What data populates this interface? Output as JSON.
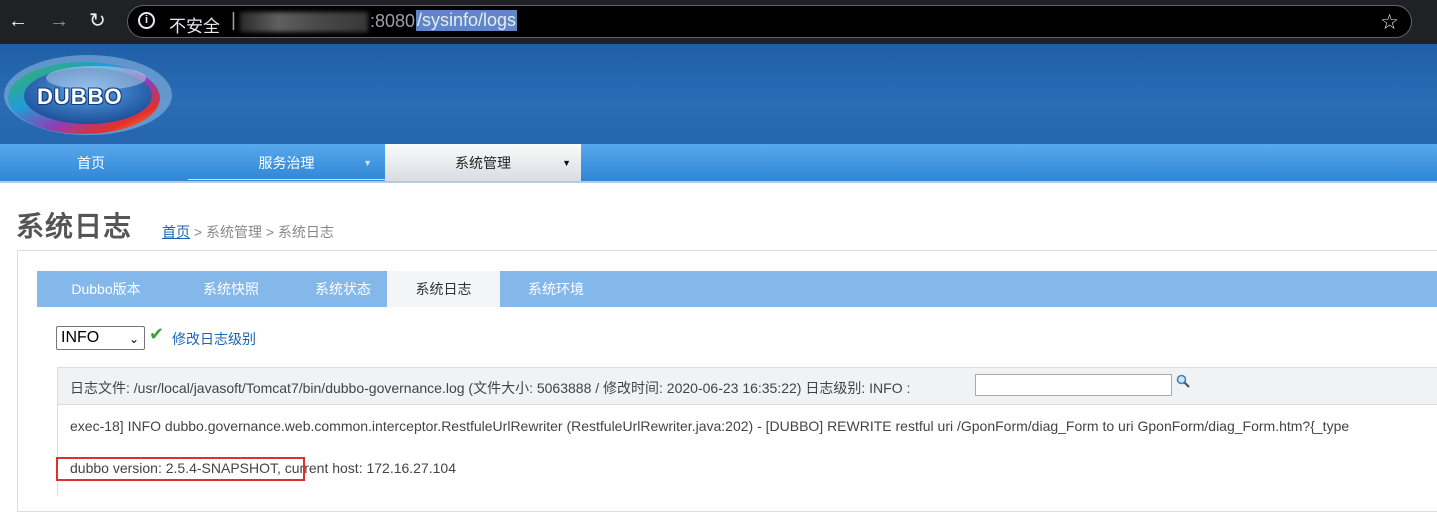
{
  "browser": {
    "insecure_label": "不安全",
    "separator": "|",
    "url_port": ":8080",
    "url_path": "/sysinfo/logs"
  },
  "logo": {
    "text": "DUBBO"
  },
  "main_nav": {
    "items": [
      {
        "label": "首页"
      },
      {
        "label": "服务治理",
        "caret": "▼"
      },
      {
        "label": "系统管理",
        "caret": "▼"
      }
    ]
  },
  "page": {
    "title": "系统日志",
    "breadcrumb": {
      "home": "首页",
      "rest": " > 系统管理 > 系统日志"
    }
  },
  "sub_tabs": [
    {
      "label": "Dubbo版本"
    },
    {
      "label": "系统快照"
    },
    {
      "label": "系统状态"
    },
    {
      "label": "系统日志",
      "active": true
    },
    {
      "label": "系统环境"
    }
  ],
  "level_select": {
    "value": "INFO",
    "caret": "⌄"
  },
  "modify_link": "修改日志级别",
  "info_bar": {
    "text": "日志文件: /usr/local/javasoft/Tomcat7/bin/dubbo-governance.log (文件大小: 5063888 / 修改时间: 2020-06-23 16:35:22) 日志级别: INFO :"
  },
  "log": {
    "line1": "exec-18] INFO dubbo.governance.web.common.interceptor.RestfuleUrlRewriter (RestfuleUrlRewriter.java:202) - [DUBBO] REWRITE restful uri /GponForm/diag_Form to uri GponForm/diag_Form.htm?{_type",
    "line2": "dubbo version: 2.5.4-SNAPSHOT, current host: 172.16.27.104"
  },
  "colors": {
    "header_blue": "#2566ae",
    "nav_blue": "#2f86d5",
    "subtab_blue": "#84b7ea",
    "link_blue": "#1a64b4",
    "highlight_red": "#e0302b",
    "check_green": "#3aa335"
  }
}
